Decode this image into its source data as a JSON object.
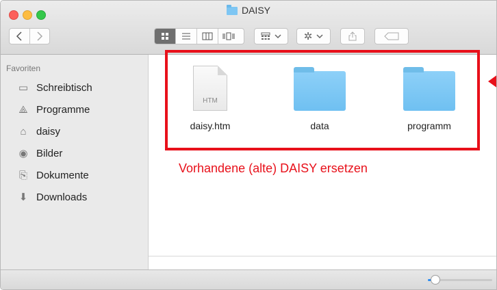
{
  "window": {
    "title": "DAISY"
  },
  "sidebar": {
    "heading": "Favoriten",
    "items": [
      {
        "label": "Schreibtisch",
        "icon": "▭"
      },
      {
        "label": "Programme",
        "icon": "⟁"
      },
      {
        "label": "daisy",
        "icon": "⌂"
      },
      {
        "label": "Bilder",
        "icon": "◉"
      },
      {
        "label": "Dokumente",
        "icon": "⎘"
      },
      {
        "label": "Downloads",
        "icon": "⬇"
      }
    ]
  },
  "files": [
    {
      "name": "daisy.htm",
      "ext": "HTM"
    },
    {
      "name": "data"
    },
    {
      "name": "programm"
    }
  ],
  "annotation": "Vorhandene (alte) DAISY ersetzen",
  "icon_size_level": 0.12,
  "colors": {
    "annotation": "#e8101a",
    "folder": "#7ec6f3",
    "accent": "#2d8cf0"
  }
}
